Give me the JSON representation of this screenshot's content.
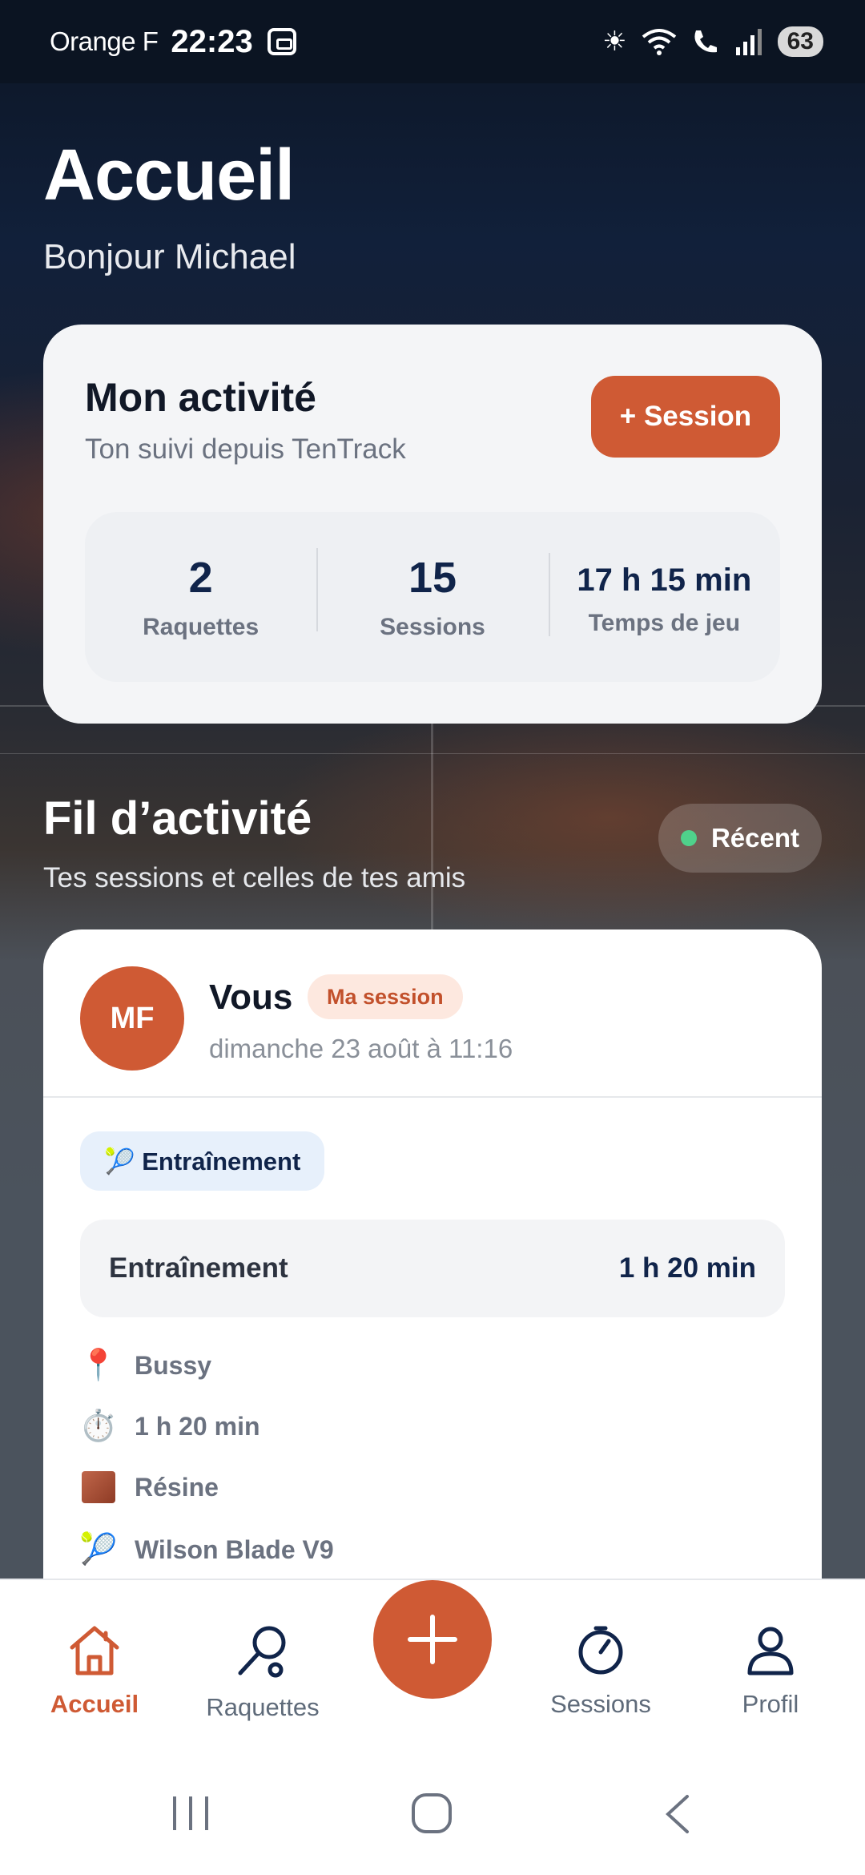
{
  "status_bar": {
    "carrier": "Orange F",
    "time": "22:23",
    "battery": "63"
  },
  "header": {
    "title": "Accueil",
    "greeting": "Bonjour Michael"
  },
  "activity": {
    "title": "Mon activité",
    "subtitle": "Ton suivi depuis TenTrack",
    "button_label": "+ Session",
    "stats": [
      {
        "value": "2",
        "label": "Raquettes"
      },
      {
        "value": "15",
        "label": "Sessions"
      },
      {
        "value": "17 h 15 min",
        "label": "Temps de jeu"
      }
    ]
  },
  "feed": {
    "title": "Fil d’activité",
    "subtitle": "Tes sessions et celles de tes amis",
    "filter_label": "Récent",
    "post": {
      "avatar_initials": "MF",
      "user": "Vous",
      "badge": "Ma session",
      "date": "dimanche 23 août à 11:16",
      "type_chip": "🎾 Entraînement",
      "summary_label": "Entraînement",
      "summary_value": "1 h 20 min",
      "details": [
        {
          "icon": "📍",
          "icon_name": "location-pin-icon",
          "text": "Bussy"
        },
        {
          "icon": "⏱️",
          "icon_name": "stopwatch-icon",
          "text": "1 h 20 min"
        },
        {
          "icon": "",
          "icon_name": "surface-swatch-icon",
          "text": "Résine"
        },
        {
          "icon": "🎾",
          "icon_name": "racket-icon",
          "text": "Wilson Blade V9"
        }
      ]
    }
  },
  "nav": {
    "items": [
      {
        "label": "Accueil"
      },
      {
        "label": "Raquettes"
      },
      {
        "label": "Sessions"
      },
      {
        "label": "Profil"
      }
    ]
  },
  "colors": {
    "accent": "#cf5a34",
    "navy": "#10244a",
    "active_nav": "#cf5a34",
    "inactive_nav": "#5f6b7a"
  }
}
